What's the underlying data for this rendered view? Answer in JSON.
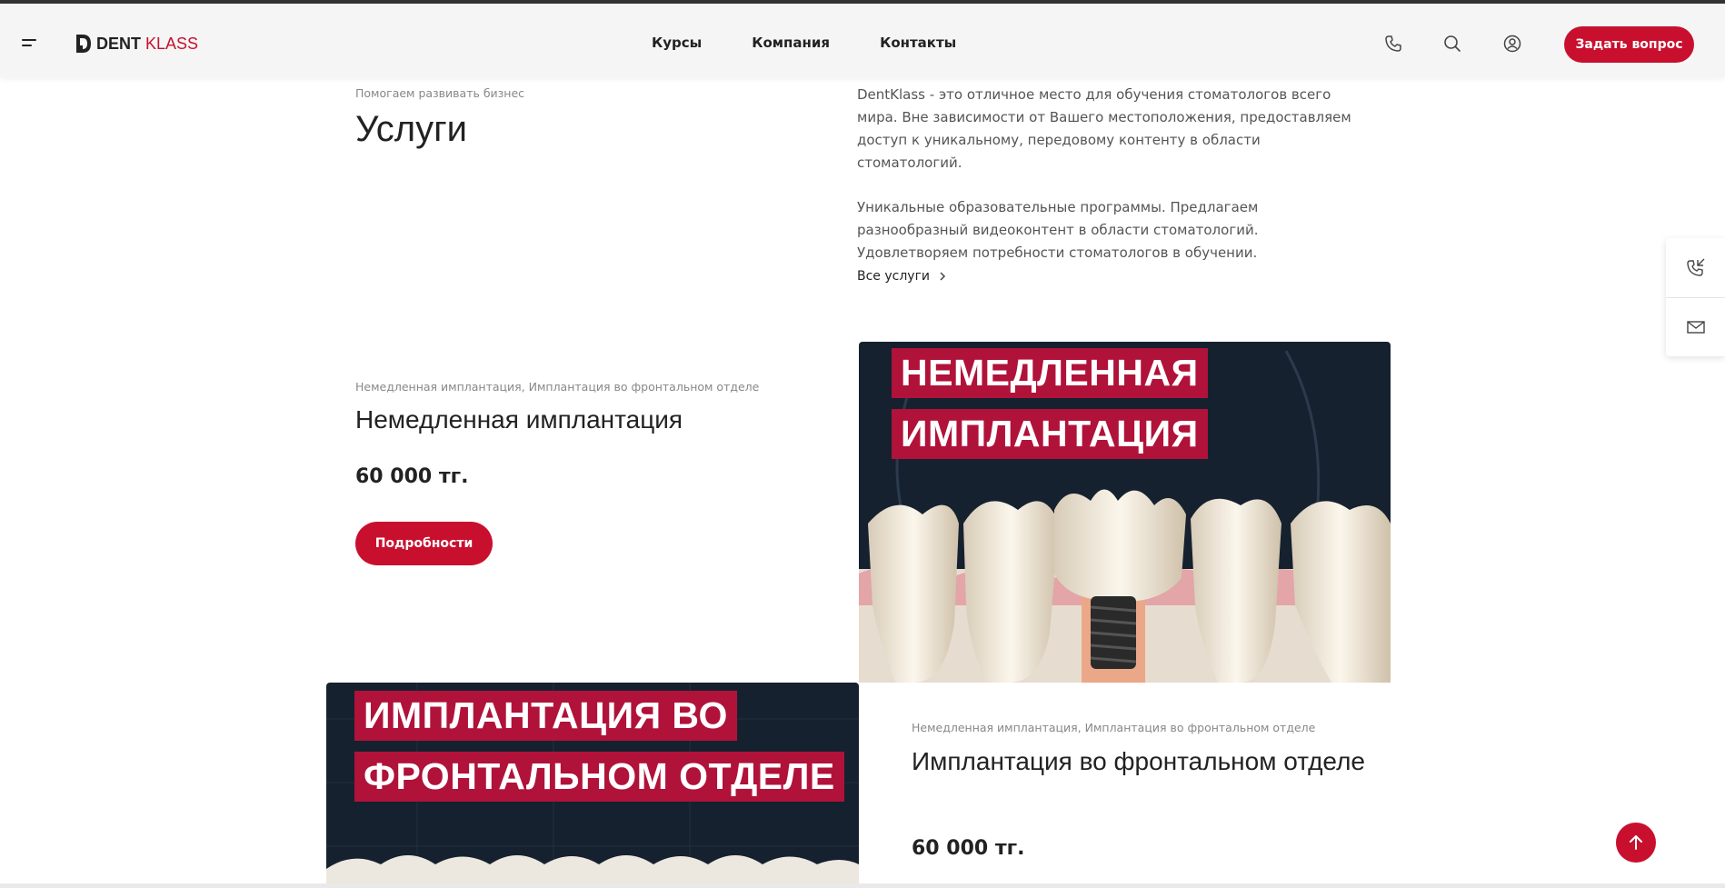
{
  "header": {
    "logo_part1": "DENT",
    "logo_part2": "KLASS",
    "nav": [
      "Курсы",
      "Компания",
      "Контакты"
    ],
    "ask_button": "Задать вопрос"
  },
  "intro": {
    "kicker": "Помогаем развивать бизнес",
    "title": "Услуги",
    "paragraph1": "DentKlass - это отличное место для обучения стоматологов всего мира. Вне зависимости от Вашего местоположения, предоставляем доступ к уникальному, передовому контенту в области стоматологий.",
    "paragraph2": "Уникальные образовательные программы. Предлагаем разнообразный видеоконтент в области стоматологий. Удовлетворяем потребности стоматологов в обучении.",
    "all_link": "Все услуги"
  },
  "cards": [
    {
      "tags": "Немедленная имплантация, Имплантация во фронтальном отделе",
      "title": "Немедленная имплантация",
      "price": "60 000 тг.",
      "button": "Подробности",
      "banner_line1": "НЕМЕДЛЕННАЯ",
      "banner_line2": "ИМПЛАНТАЦИЯ"
    },
    {
      "tags": "Немедленная имплантация, Имплантация во фронтальном отделе",
      "title": "Имплантация во фронтальном отделе",
      "price": "60 000 тг.",
      "banner_line1": "ИМПЛАНТАЦИЯ ВО",
      "banner_line2": "ФРОНТАЛЬНОМ ОТДЕЛЕ"
    }
  ],
  "colors": {
    "accent": "#c8102e",
    "banner_bg": "#16212f",
    "banner_tag": "#b0123a"
  }
}
